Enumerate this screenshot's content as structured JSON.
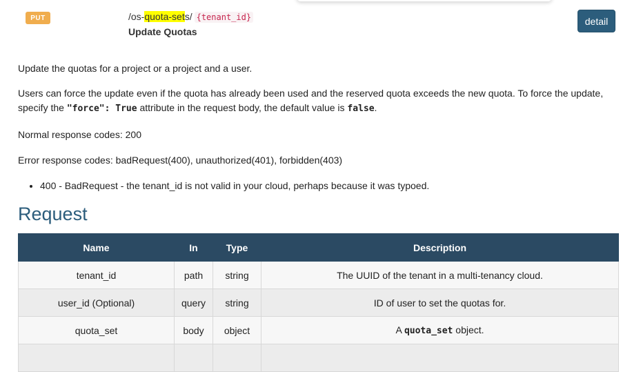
{
  "endpoint": {
    "method": "PUT",
    "path_prefix": "/os-",
    "path_highlight": "quota-set",
    "path_suffix": "s/",
    "path_param": "{tenant_id}",
    "summary": "Update Quotas",
    "detail_button": "detail"
  },
  "body": {
    "p1": "Update the quotas for a project or a project and a user.",
    "p2_a": "Users can force the update even if the quota has already been used and the reserved quota exceeds the new quota. To force the update, specify the ",
    "p2_code1": "\"force\": True",
    "p2_b": " attribute in the request body, the default value is ",
    "p2_code2": "false",
    "p2_c": ".",
    "normal_codes": "Normal response codes: 200",
    "error_codes": "Error response codes: badRequest(400), unauthorized(401), forbidden(403)",
    "bullets": [
      "400 - BadRequest - the tenant_id is not valid in your cloud, perhaps because it was typoed."
    ]
  },
  "request": {
    "title": "Request",
    "headers": [
      "Name",
      "In",
      "Type",
      "Description"
    ],
    "rows": [
      {
        "name": "tenant_id",
        "in": "path",
        "type": "string",
        "desc_a": "The UUID of the tenant in a multi-tenancy cloud.",
        "desc_code": "",
        "desc_b": ""
      },
      {
        "name": "user_id (Optional)",
        "in": "query",
        "type": "string",
        "desc_a": "ID of user to set the quotas for.",
        "desc_code": "",
        "desc_b": ""
      },
      {
        "name": "quota_set",
        "in": "body",
        "type": "object",
        "desc_a": "A ",
        "desc_code": "quota_set",
        "desc_b": " object."
      },
      {
        "name": "",
        "in": "",
        "type": "",
        "desc_a": "",
        "desc_code": "",
        "desc_b": ""
      }
    ]
  }
}
